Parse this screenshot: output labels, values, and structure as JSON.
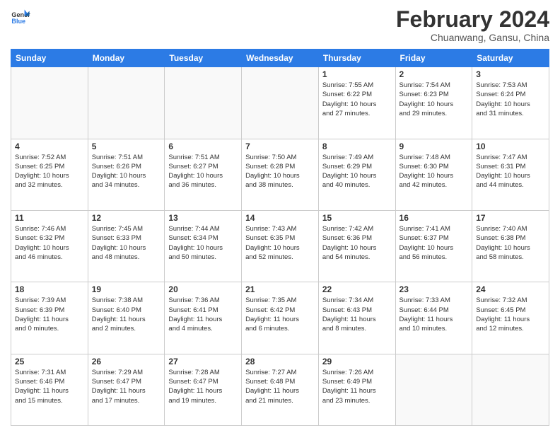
{
  "header": {
    "logo_general": "General",
    "logo_blue": "Blue",
    "month_year": "February 2024",
    "location": "Chuanwang, Gansu, China"
  },
  "days_of_week": [
    "Sunday",
    "Monday",
    "Tuesday",
    "Wednesday",
    "Thursday",
    "Friday",
    "Saturday"
  ],
  "weeks": [
    [
      {
        "day": "",
        "info": ""
      },
      {
        "day": "",
        "info": ""
      },
      {
        "day": "",
        "info": ""
      },
      {
        "day": "",
        "info": ""
      },
      {
        "day": "1",
        "info": "Sunrise: 7:55 AM\nSunset: 6:22 PM\nDaylight: 10 hours\nand 27 minutes."
      },
      {
        "day": "2",
        "info": "Sunrise: 7:54 AM\nSunset: 6:23 PM\nDaylight: 10 hours\nand 29 minutes."
      },
      {
        "day": "3",
        "info": "Sunrise: 7:53 AM\nSunset: 6:24 PM\nDaylight: 10 hours\nand 31 minutes."
      }
    ],
    [
      {
        "day": "4",
        "info": "Sunrise: 7:52 AM\nSunset: 6:25 PM\nDaylight: 10 hours\nand 32 minutes."
      },
      {
        "day": "5",
        "info": "Sunrise: 7:51 AM\nSunset: 6:26 PM\nDaylight: 10 hours\nand 34 minutes."
      },
      {
        "day": "6",
        "info": "Sunrise: 7:51 AM\nSunset: 6:27 PM\nDaylight: 10 hours\nand 36 minutes."
      },
      {
        "day": "7",
        "info": "Sunrise: 7:50 AM\nSunset: 6:28 PM\nDaylight: 10 hours\nand 38 minutes."
      },
      {
        "day": "8",
        "info": "Sunrise: 7:49 AM\nSunset: 6:29 PM\nDaylight: 10 hours\nand 40 minutes."
      },
      {
        "day": "9",
        "info": "Sunrise: 7:48 AM\nSunset: 6:30 PM\nDaylight: 10 hours\nand 42 minutes."
      },
      {
        "day": "10",
        "info": "Sunrise: 7:47 AM\nSunset: 6:31 PM\nDaylight: 10 hours\nand 44 minutes."
      }
    ],
    [
      {
        "day": "11",
        "info": "Sunrise: 7:46 AM\nSunset: 6:32 PM\nDaylight: 10 hours\nand 46 minutes."
      },
      {
        "day": "12",
        "info": "Sunrise: 7:45 AM\nSunset: 6:33 PM\nDaylight: 10 hours\nand 48 minutes."
      },
      {
        "day": "13",
        "info": "Sunrise: 7:44 AM\nSunset: 6:34 PM\nDaylight: 10 hours\nand 50 minutes."
      },
      {
        "day": "14",
        "info": "Sunrise: 7:43 AM\nSunset: 6:35 PM\nDaylight: 10 hours\nand 52 minutes."
      },
      {
        "day": "15",
        "info": "Sunrise: 7:42 AM\nSunset: 6:36 PM\nDaylight: 10 hours\nand 54 minutes."
      },
      {
        "day": "16",
        "info": "Sunrise: 7:41 AM\nSunset: 6:37 PM\nDaylight: 10 hours\nand 56 minutes."
      },
      {
        "day": "17",
        "info": "Sunrise: 7:40 AM\nSunset: 6:38 PM\nDaylight: 10 hours\nand 58 minutes."
      }
    ],
    [
      {
        "day": "18",
        "info": "Sunrise: 7:39 AM\nSunset: 6:39 PM\nDaylight: 11 hours\nand 0 minutes."
      },
      {
        "day": "19",
        "info": "Sunrise: 7:38 AM\nSunset: 6:40 PM\nDaylight: 11 hours\nand 2 minutes."
      },
      {
        "day": "20",
        "info": "Sunrise: 7:36 AM\nSunset: 6:41 PM\nDaylight: 11 hours\nand 4 minutes."
      },
      {
        "day": "21",
        "info": "Sunrise: 7:35 AM\nSunset: 6:42 PM\nDaylight: 11 hours\nand 6 minutes."
      },
      {
        "day": "22",
        "info": "Sunrise: 7:34 AM\nSunset: 6:43 PM\nDaylight: 11 hours\nand 8 minutes."
      },
      {
        "day": "23",
        "info": "Sunrise: 7:33 AM\nSunset: 6:44 PM\nDaylight: 11 hours\nand 10 minutes."
      },
      {
        "day": "24",
        "info": "Sunrise: 7:32 AM\nSunset: 6:45 PM\nDaylight: 11 hours\nand 12 minutes."
      }
    ],
    [
      {
        "day": "25",
        "info": "Sunrise: 7:31 AM\nSunset: 6:46 PM\nDaylight: 11 hours\nand 15 minutes."
      },
      {
        "day": "26",
        "info": "Sunrise: 7:29 AM\nSunset: 6:47 PM\nDaylight: 11 hours\nand 17 minutes."
      },
      {
        "day": "27",
        "info": "Sunrise: 7:28 AM\nSunset: 6:47 PM\nDaylight: 11 hours\nand 19 minutes."
      },
      {
        "day": "28",
        "info": "Sunrise: 7:27 AM\nSunset: 6:48 PM\nDaylight: 11 hours\nand 21 minutes."
      },
      {
        "day": "29",
        "info": "Sunrise: 7:26 AM\nSunset: 6:49 PM\nDaylight: 11 hours\nand 23 minutes."
      },
      {
        "day": "",
        "info": ""
      },
      {
        "day": "",
        "info": ""
      }
    ]
  ]
}
